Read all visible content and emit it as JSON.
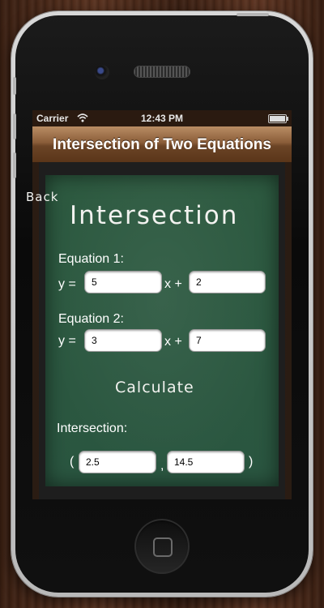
{
  "status_bar": {
    "carrier": "Carrier",
    "time": "12:43 PM"
  },
  "nav": {
    "title": "Intersection of Two Equations"
  },
  "board": {
    "back_label": "Back",
    "heading": "Intersection",
    "equation1": {
      "label": "Equation 1:",
      "y_prefix": "y =",
      "x_suffix": "x +",
      "slope": "5",
      "intercept": "2"
    },
    "equation2": {
      "label": "Equation 2:",
      "y_prefix": "y =",
      "x_suffix": "x +",
      "slope": "3",
      "intercept": "7"
    },
    "calculate_label": "Calculate",
    "result": {
      "label": "Intersection:",
      "open_paren": "(",
      "comma": ",",
      "close_paren": ")",
      "x": "2.5",
      "y": "14.5"
    }
  },
  "colors": {
    "chalkboard": "#2d5a40",
    "navbar_wood": "#8a5d39",
    "chalk": "#f2f2ef"
  },
  "icons": {
    "wifi": "wifi-icon",
    "battery": "battery-icon",
    "home": "home-button-icon"
  }
}
